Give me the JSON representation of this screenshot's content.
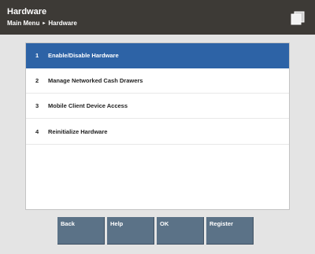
{
  "header": {
    "title": "Hardware",
    "breadcrumb": [
      "Main Menu",
      "Hardware"
    ],
    "breadcrumb_separator": "▸",
    "icon": "documents-icon"
  },
  "menu": {
    "items": [
      {
        "number": "1",
        "label": "Enable/Disable Hardware",
        "selected": true
      },
      {
        "number": "2",
        "label": "Manage Networked Cash Drawers",
        "selected": false
      },
      {
        "number": "3",
        "label": "Mobile Client Device Access",
        "selected": false
      },
      {
        "number": "4",
        "label": "Reinitialize Hardware",
        "selected": false
      }
    ]
  },
  "buttons": {
    "back": "Back",
    "help": "Help",
    "ok": "OK",
    "register": "Register"
  },
  "colors": {
    "header_bg": "#3d3a36",
    "selected_bg": "#2d63a6",
    "button_bg": "#5b7287",
    "app_bg": "#e4e4e4"
  }
}
